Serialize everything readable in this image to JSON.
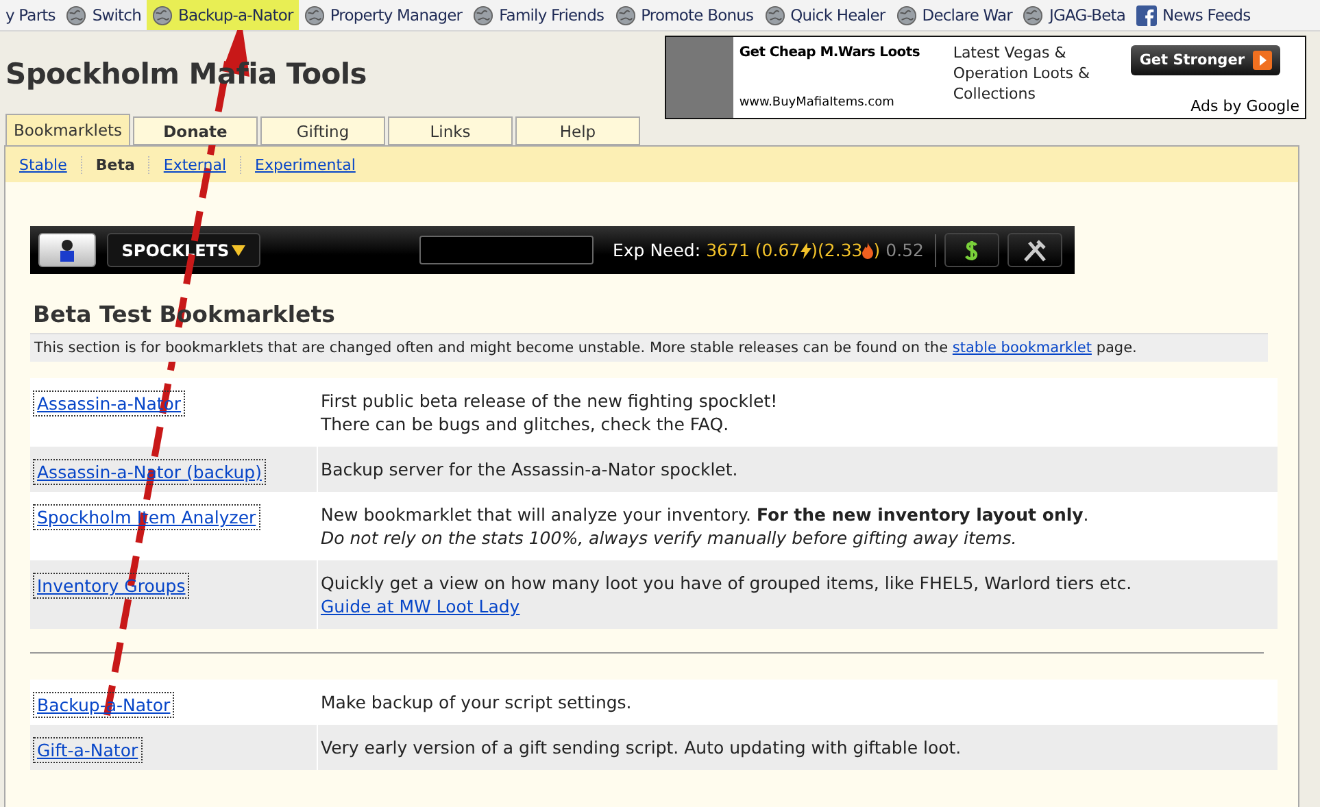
{
  "bookmarks": [
    {
      "label": "y Parts",
      "highlighted": false
    },
    {
      "label": "Switch",
      "highlighted": false
    },
    {
      "label": "Backup-a-Nator",
      "highlighted": true
    },
    {
      "label": "Property Manager",
      "highlighted": false
    },
    {
      "label": "Family Friends",
      "highlighted": false
    },
    {
      "label": "Promote Bonus",
      "highlighted": false
    },
    {
      "label": "Quick Healer",
      "highlighted": false
    },
    {
      "label": "Declare War",
      "highlighted": false
    },
    {
      "label": "JGAG-Beta",
      "highlighted": false
    },
    {
      "label": "News Feeds",
      "highlighted": false
    }
  ],
  "page_title": "Spockholm Mafia Tools",
  "ad": {
    "headline": "Get Cheap M.Wars Loots",
    "url": "www.BuyMafiaItems.com",
    "text": "Latest Vegas & Operation Loots & Collections",
    "button": "Get Stronger",
    "attribution": "Ads by Google"
  },
  "tabs": [
    {
      "label": "Bookmarklets",
      "selected": true,
      "bold": false
    },
    {
      "label": "Donate",
      "selected": false,
      "bold": true
    },
    {
      "label": "Gifting",
      "selected": false,
      "bold": false
    },
    {
      "label": "Links",
      "selected": false,
      "bold": false
    },
    {
      "label": "Help",
      "selected": false,
      "bold": false
    }
  ],
  "subtabs": [
    {
      "label": "Stable",
      "selected": false
    },
    {
      "label": "Beta",
      "selected": true
    },
    {
      "label": "External",
      "selected": false
    },
    {
      "label": "Experimental",
      "selected": false
    }
  ],
  "toolbar": {
    "menu": "SPOCKLETS",
    "exp_label": "Exp Need:",
    "exp_value": "3671",
    "open_paren": "(",
    "energy_ratio": "0.67",
    "mid_paren": ")(",
    "stamina_ratio": "2.33",
    "close_paren": ")",
    "other_ratio": "0.52"
  },
  "section_title": "Beta Test Bookmarklets",
  "info": {
    "text": "This section is for bookmarklets that are changed often and might become unstable. More stable releases can be found on the",
    "link": "stable bookmarklet",
    "after": "page."
  },
  "groups": [
    {
      "rows": [
        {
          "name": "Assassin-a-Nator",
          "lines": [
            {
              "kind": "plain",
              "text": "First public beta release of the new fighting spocklet!"
            },
            {
              "kind": "plain",
              "text": "There can be bugs and glitches, check the FAQ."
            }
          ]
        },
        {
          "name": "Assassin-a-Nator (backup)",
          "lines": [
            {
              "kind": "plain",
              "text": "Backup server for the Assassin-a-Nator spocklet."
            }
          ]
        },
        {
          "name": "Spockholm Item Analyzer",
          "lines": [
            {
              "kind": "plain",
              "text": "New bookmarklet that will analyze your inventory. **For the new inventory layout only**."
            },
            {
              "kind": "note",
              "text": "Do not rely on the stats 100%, always verify manually before gifting away items."
            }
          ]
        },
        {
          "name": "Inventory Groups",
          "lines": [
            {
              "kind": "link",
              "text": "Quickly get a view on how many loot you have of grouped items, like FHEL5, Warlord tiers etc.",
              "link": "Guide at MW Loot Lady"
            }
          ]
        }
      ]
    },
    {
      "rows": [
        {
          "name": "Backup-a-Nator",
          "lines": [
            {
              "kind": "plain",
              "text": "Make backup of your script settings."
            }
          ]
        },
        {
          "name": "Gift-a-Nator",
          "lines": [
            {
              "kind": "plain",
              "text": "Very early version of a gift sending script. Auto updating with giftable loot."
            }
          ]
        }
      ]
    }
  ]
}
